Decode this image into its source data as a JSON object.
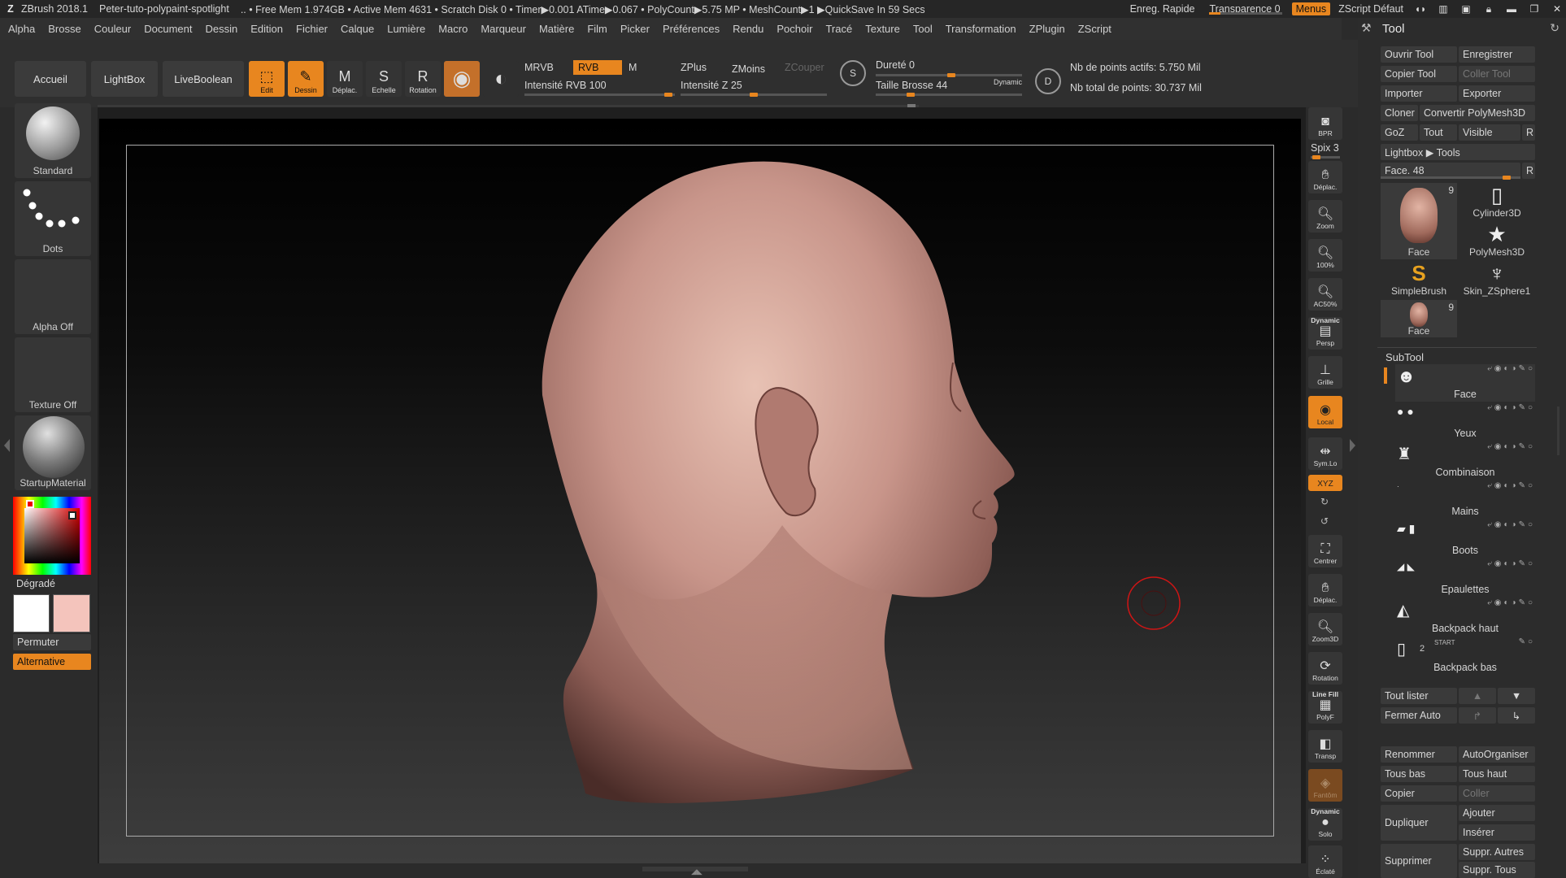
{
  "titlebar": {
    "app": "ZBrush 2018.1",
    "document": "Peter-tuto-polypaint-spotlight",
    "stats": ".. • Free Mem 1.974GB • Active Mem 4631 • Scratch Disk 0 • Timer▶0.001 ATime▶0.067 • PolyCount▶5.75 MP • MeshCount▶1 ▶QuickSave In 59 Secs",
    "enreg": "Enreg. Rapide",
    "transparence": "Transparence 0",
    "menus": "Menus",
    "zscript_default": "ZScript Défaut"
  },
  "menubar": [
    "Alpha",
    "Brosse",
    "Couleur",
    "Document",
    "Dessin",
    "Edition",
    "Fichier",
    "Calque",
    "Lumière",
    "Macro",
    "Marqueur",
    "Matière",
    "Film",
    "Picker",
    "Préférences",
    "Rendu",
    "Pochoir",
    "Tracé",
    "Texture",
    "Tool",
    "Transformation",
    "ZPlugin",
    "ZScript"
  ],
  "shelf": {
    "accueil": "Accueil",
    "lightbox": "LightBox",
    "liveboolean": "LiveBoolean",
    "edit": "Edit",
    "dessin": "Dessin",
    "deplac": "Déplac.",
    "echelle": "Echelle",
    "rotation": "Rotation",
    "mrvb": "MRVB",
    "rvb": "RVB",
    "m": "M",
    "intensite_rvb": "Intensité RVB 100",
    "zplus": "ZPlus",
    "zmoins": "ZMoins",
    "zcouper": "ZCouper",
    "intensite_z": "Intensité Z 25",
    "durete": "Dureté 0",
    "taille_brosse": "Taille Brosse 44",
    "dynamic": "Dynamic",
    "points_actifs": "Nb de points actifs: 5.750 Mil",
    "points_total": "Nb total de points: 30.737 Mil",
    "rvb_intensity_value": 100,
    "z_intensity_value": 25,
    "durete_value": 0,
    "taille_value": 44
  },
  "left": {
    "brush": "Standard",
    "stroke": "Dots",
    "alpha": "Alpha Off",
    "texture": "Texture Off",
    "material": "StartupMaterial",
    "degrade": "Dégradé",
    "permuter": "Permuter",
    "alternative": "Alternative",
    "main_color": "#ffffff",
    "secondary_color": "#f4c4bc"
  },
  "rightcol": {
    "bpr": "BPR",
    "spix": "Spix 3",
    "deplac": "Déplac.",
    "zoom": "Zoom",
    "p100": "100%",
    "ac50": "AC50%",
    "dynamic": "Dynamic",
    "persp": "Persp",
    "grille": "Grille",
    "local": "Local",
    "symlo": "Sym.Lo",
    "xyz": "XYZ",
    "centrer": "Centrer",
    "deplac2": "Déplac.",
    "zoom3d": "Zoom3D",
    "rotation": "Rotation",
    "linefill": "Line Fill",
    "polyf": "PolyF",
    "transp": "Transp",
    "fantom": "Fantôm",
    "dynamic2": "Dynamic",
    "solo": "Solo",
    "eclate": "Éclaté"
  },
  "tool": {
    "title": "Tool",
    "ouvrir": "Ouvrir Tool",
    "enregistrer": "Enregistrer",
    "copier": "Copier Tool",
    "coller": "Coller Tool",
    "importer": "Importer",
    "exporter": "Exporter",
    "cloner": "Cloner",
    "convertir": "Convertir PolyMesh3D",
    "goz": "GoZ",
    "tout": "Tout",
    "visible": "Visible",
    "r": "R",
    "lightbox_tools": "Lightbox ▶ Tools",
    "face_slider": "Face. 48",
    "r2": "R",
    "thumbs": {
      "face": "Face",
      "face_count": "9",
      "cylinder": "Cylinder3D",
      "polymesh": "PolyMesh3D",
      "simplebrush": "SimpleBrush",
      "skin": "Skin_ZSphere1",
      "face2": "Face",
      "face2_count": "9"
    }
  },
  "subtool": {
    "title": "SubTool",
    "items": [
      "Face",
      "Yeux",
      "Combinaison",
      "Mains",
      "Boots",
      "Epaulettes",
      "Backpack haut",
      "Backpack bas"
    ],
    "backpack_bas_count": "2",
    "start": "START",
    "tout_lister": "Tout lister",
    "fermer_auto": "Fermer Auto",
    "renommer": "Renommer",
    "autoorganiser": "AutoOrganiser",
    "tous_bas": "Tous bas",
    "tous_haut": "Tous haut",
    "copier": "Copier",
    "coller": "Coller",
    "dupliquer": "Dupliquer",
    "ajouter": "Ajouter",
    "inserer": "Insérer",
    "supprimer": "Supprimer",
    "suppr_autres": "Suppr. Autres",
    "suppr_tous": "Suppr. Tous"
  },
  "colors": {
    "accent": "#e8861f",
    "panel": "#2c2c2c",
    "button": "#3a3a3a"
  }
}
